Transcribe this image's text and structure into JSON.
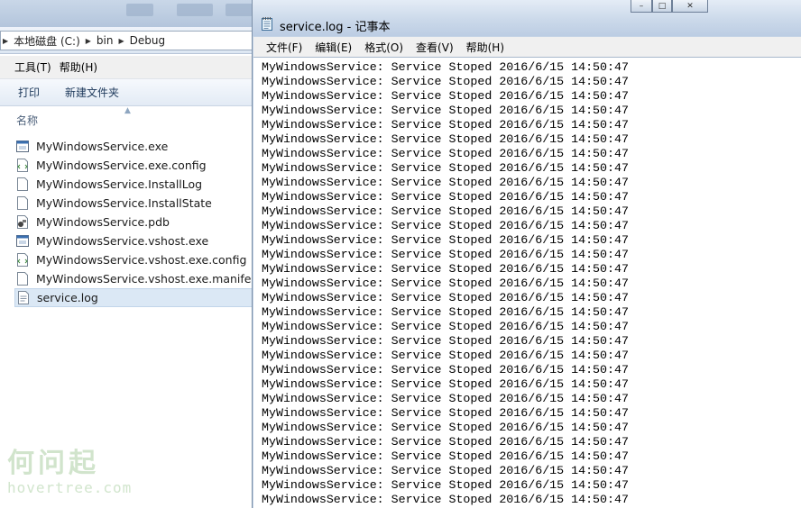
{
  "explorer": {
    "address": {
      "segments": [
        "本地磁盘 (C:)",
        "bin",
        "Debug"
      ]
    },
    "menu": [
      "工具(T)",
      "帮助(H)"
    ],
    "toolbar": {
      "print_label": "打印",
      "new_folder_label": "新建文件夹"
    },
    "column_header": "名称",
    "files": [
      {
        "name": "MyWindowsService.exe",
        "icon": "exe-icon"
      },
      {
        "name": "MyWindowsService.exe.config",
        "icon": "config-file-icon"
      },
      {
        "name": "MyWindowsService.InstallLog",
        "icon": "document-icon"
      },
      {
        "name": "MyWindowsService.InstallState",
        "icon": "document-icon"
      },
      {
        "name": "MyWindowsService.pdb",
        "icon": "pdb-file-icon"
      },
      {
        "name": "MyWindowsService.vshost.exe",
        "icon": "exe-icon"
      },
      {
        "name": "MyWindowsService.vshost.exe.config",
        "icon": "config-file-icon"
      },
      {
        "name": "MyWindowsService.vshost.exe.manife...",
        "icon": "document-icon"
      },
      {
        "name": "service.log",
        "icon": "text-file-icon",
        "selected": true
      }
    ]
  },
  "notepad": {
    "title": "service.log - 记事本",
    "menu": [
      "文件(F)",
      "编辑(E)",
      "格式(O)",
      "查看(V)",
      "帮助(H)"
    ],
    "lines": [
      "MyWindowsService: Service Stoped 2016/6/15 14:50:47",
      "MyWindowsService: Service Stoped 2016/6/15 14:50:47",
      "MyWindowsService: Service Stoped 2016/6/15 14:50:47",
      "MyWindowsService: Service Stoped 2016/6/15 14:50:47",
      "MyWindowsService: Service Stoped 2016/6/15 14:50:47",
      "MyWindowsService: Service Stoped 2016/6/15 14:50:47",
      "MyWindowsService: Service Stoped 2016/6/15 14:50:47",
      "MyWindowsService: Service Stoped 2016/6/15 14:50:47",
      "MyWindowsService: Service Stoped 2016/6/15 14:50:47",
      "MyWindowsService: Service Stoped 2016/6/15 14:50:47",
      "MyWindowsService: Service Stoped 2016/6/15 14:50:47",
      "MyWindowsService: Service Stoped 2016/6/15 14:50:47",
      "MyWindowsService: Service Stoped 2016/6/15 14:50:47",
      "MyWindowsService: Service Stoped 2016/6/15 14:50:47",
      "MyWindowsService: Service Stoped 2016/6/15 14:50:47",
      "MyWindowsService: Service Stoped 2016/6/15 14:50:47",
      "MyWindowsService: Service Stoped 2016/6/15 14:50:47",
      "MyWindowsService: Service Stoped 2016/6/15 14:50:47",
      "MyWindowsService: Service Stoped 2016/6/15 14:50:47",
      "MyWindowsService: Service Stoped 2016/6/15 14:50:47",
      "MyWindowsService: Service Stoped 2016/6/15 14:50:47",
      "MyWindowsService: Service Stoped 2016/6/15 14:50:47",
      "MyWindowsService: Service Stoped 2016/6/15 14:50:47",
      "MyWindowsService: Service Stoped 2016/6/15 14:50:47",
      "MyWindowsService: Service Stoped 2016/6/15 14:50:47",
      "MyWindowsService: Service Stoped 2016/6/15 14:50:47",
      "MyWindowsService: Service Stoped 2016/6/15 14:50:47",
      "MyWindowsService: Service Stoped 2016/6/15 14:50:47",
      "MyWindowsService: Service Stoped 2016/6/15 14:50:47",
      "MyWindowsService: Service Stoped 2016/6/15 14:50:47",
      "MyWindowsService: Service Stoped 2016/6/15 14:50:47"
    ]
  },
  "watermark": {
    "chinese": "何问起",
    "latin": "hovertree.com"
  },
  "colors": {
    "selection": "#dbe8f5",
    "titlebar": "#cbd9ea",
    "watermark": "#c9e0c4"
  }
}
